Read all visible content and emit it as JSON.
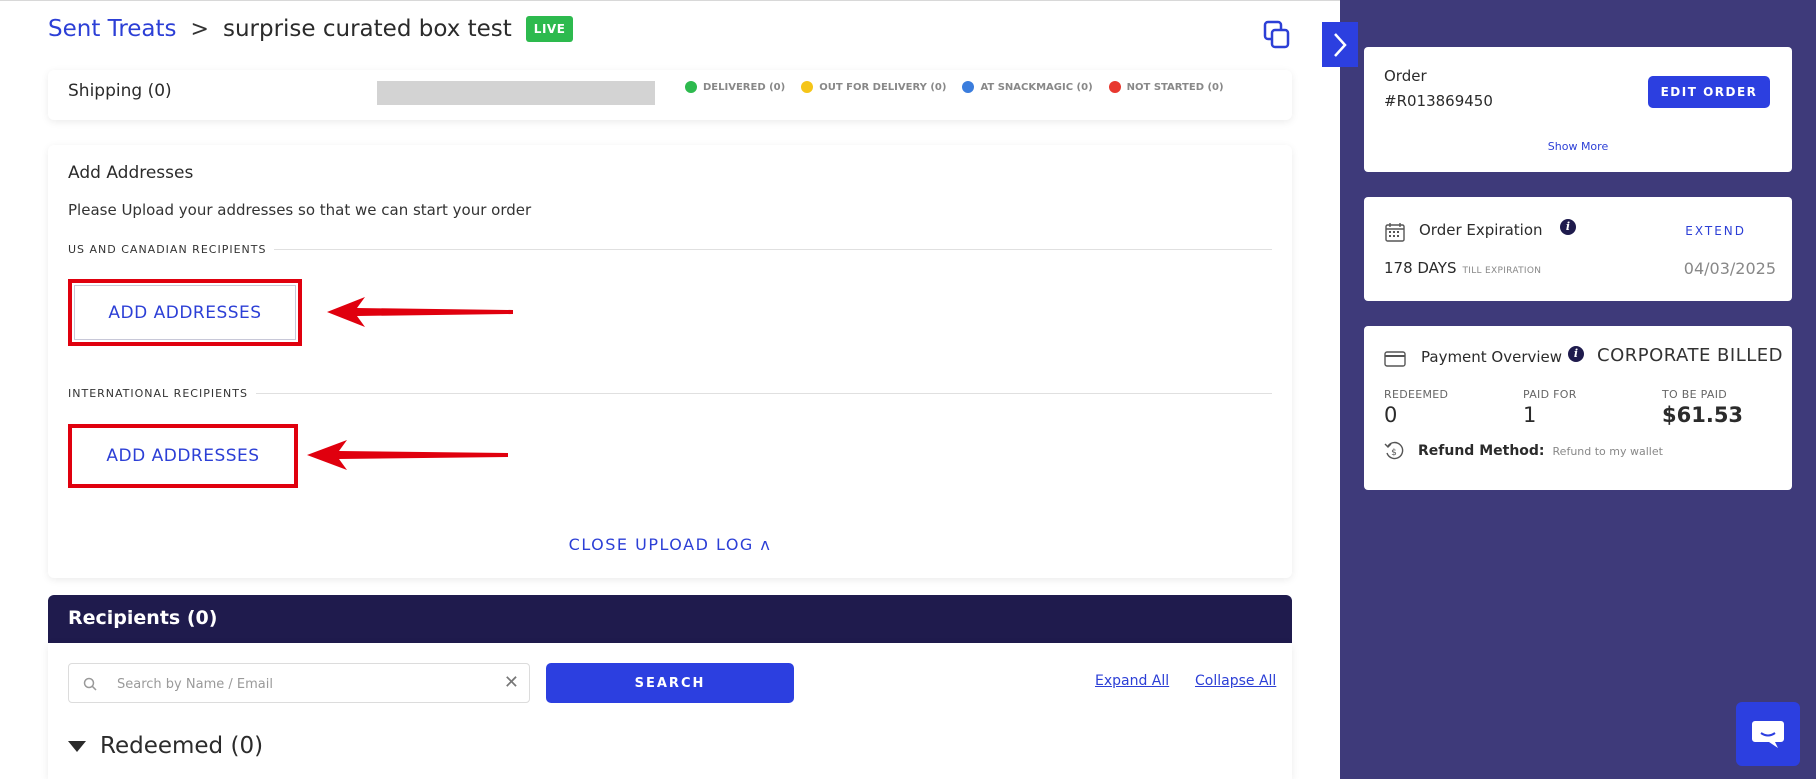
{
  "header": {
    "breadcrumb_link": "Sent Treats",
    "separator": ">",
    "title": "surprise curated box test",
    "status_badge": "LIVE"
  },
  "shipping": {
    "title": "Shipping (0)",
    "legend": [
      {
        "label": "DELIVERED (0)",
        "color": "#2dba4e"
      },
      {
        "label": "OUT FOR DELIVERY (0)",
        "color": "#f5c518"
      },
      {
        "label": "AT SNACKMAGIC (0)",
        "color": "#3b7ddd"
      },
      {
        "label": "NOT STARTED (0)",
        "color": "#e8382f"
      }
    ]
  },
  "upload": {
    "title": "Add Addresses",
    "description": "Please Upload your addresses so that we can start your order",
    "us_section_label": "US AND CANADIAN RECIPIENTS",
    "us_button": "ADD ADDRESSES",
    "intl_section_label": "INTERNATIONAL RECIPIENTS",
    "intl_button": "ADD ADDRESSES",
    "close_log": "CLOSE UPLOAD LOG ʌ"
  },
  "recipients": {
    "title": "Recipients (0)",
    "search_placeholder": "Search by Name / Email",
    "search_button": "SEARCH",
    "expand_all": "Expand All",
    "collapse_all": "Collapse All",
    "redeemed_group": "Redeemed (0)"
  },
  "sidebar": {
    "order": {
      "label": "Order",
      "number": "#R013869450",
      "edit_button": "EDIT ORDER",
      "show_more": "Show More"
    },
    "expiration": {
      "title": "Order Expiration",
      "extend": "EXTEND",
      "days": "178 DAYS",
      "days_suffix": "TILL EXPIRATION",
      "date": "04/03/2025"
    },
    "payment": {
      "title": "Payment Overview",
      "type": "CORPORATE BILLED",
      "redeemed_label": "REDEEMED",
      "redeemed_value": "0",
      "paid_label": "PAID FOR",
      "paid_value": "1",
      "tobepaid_label": "TO BE PAID",
      "tobepaid_value": "$61.53",
      "refund_label": "Refund Method:",
      "refund_value": "Refund to my wallet"
    }
  },
  "colors": {
    "brand_blue": "#2c3fe0",
    "navy": "#1f1b4d",
    "sidebar_bg": "#3e3a7a",
    "annotation_red": "#e0000e"
  }
}
